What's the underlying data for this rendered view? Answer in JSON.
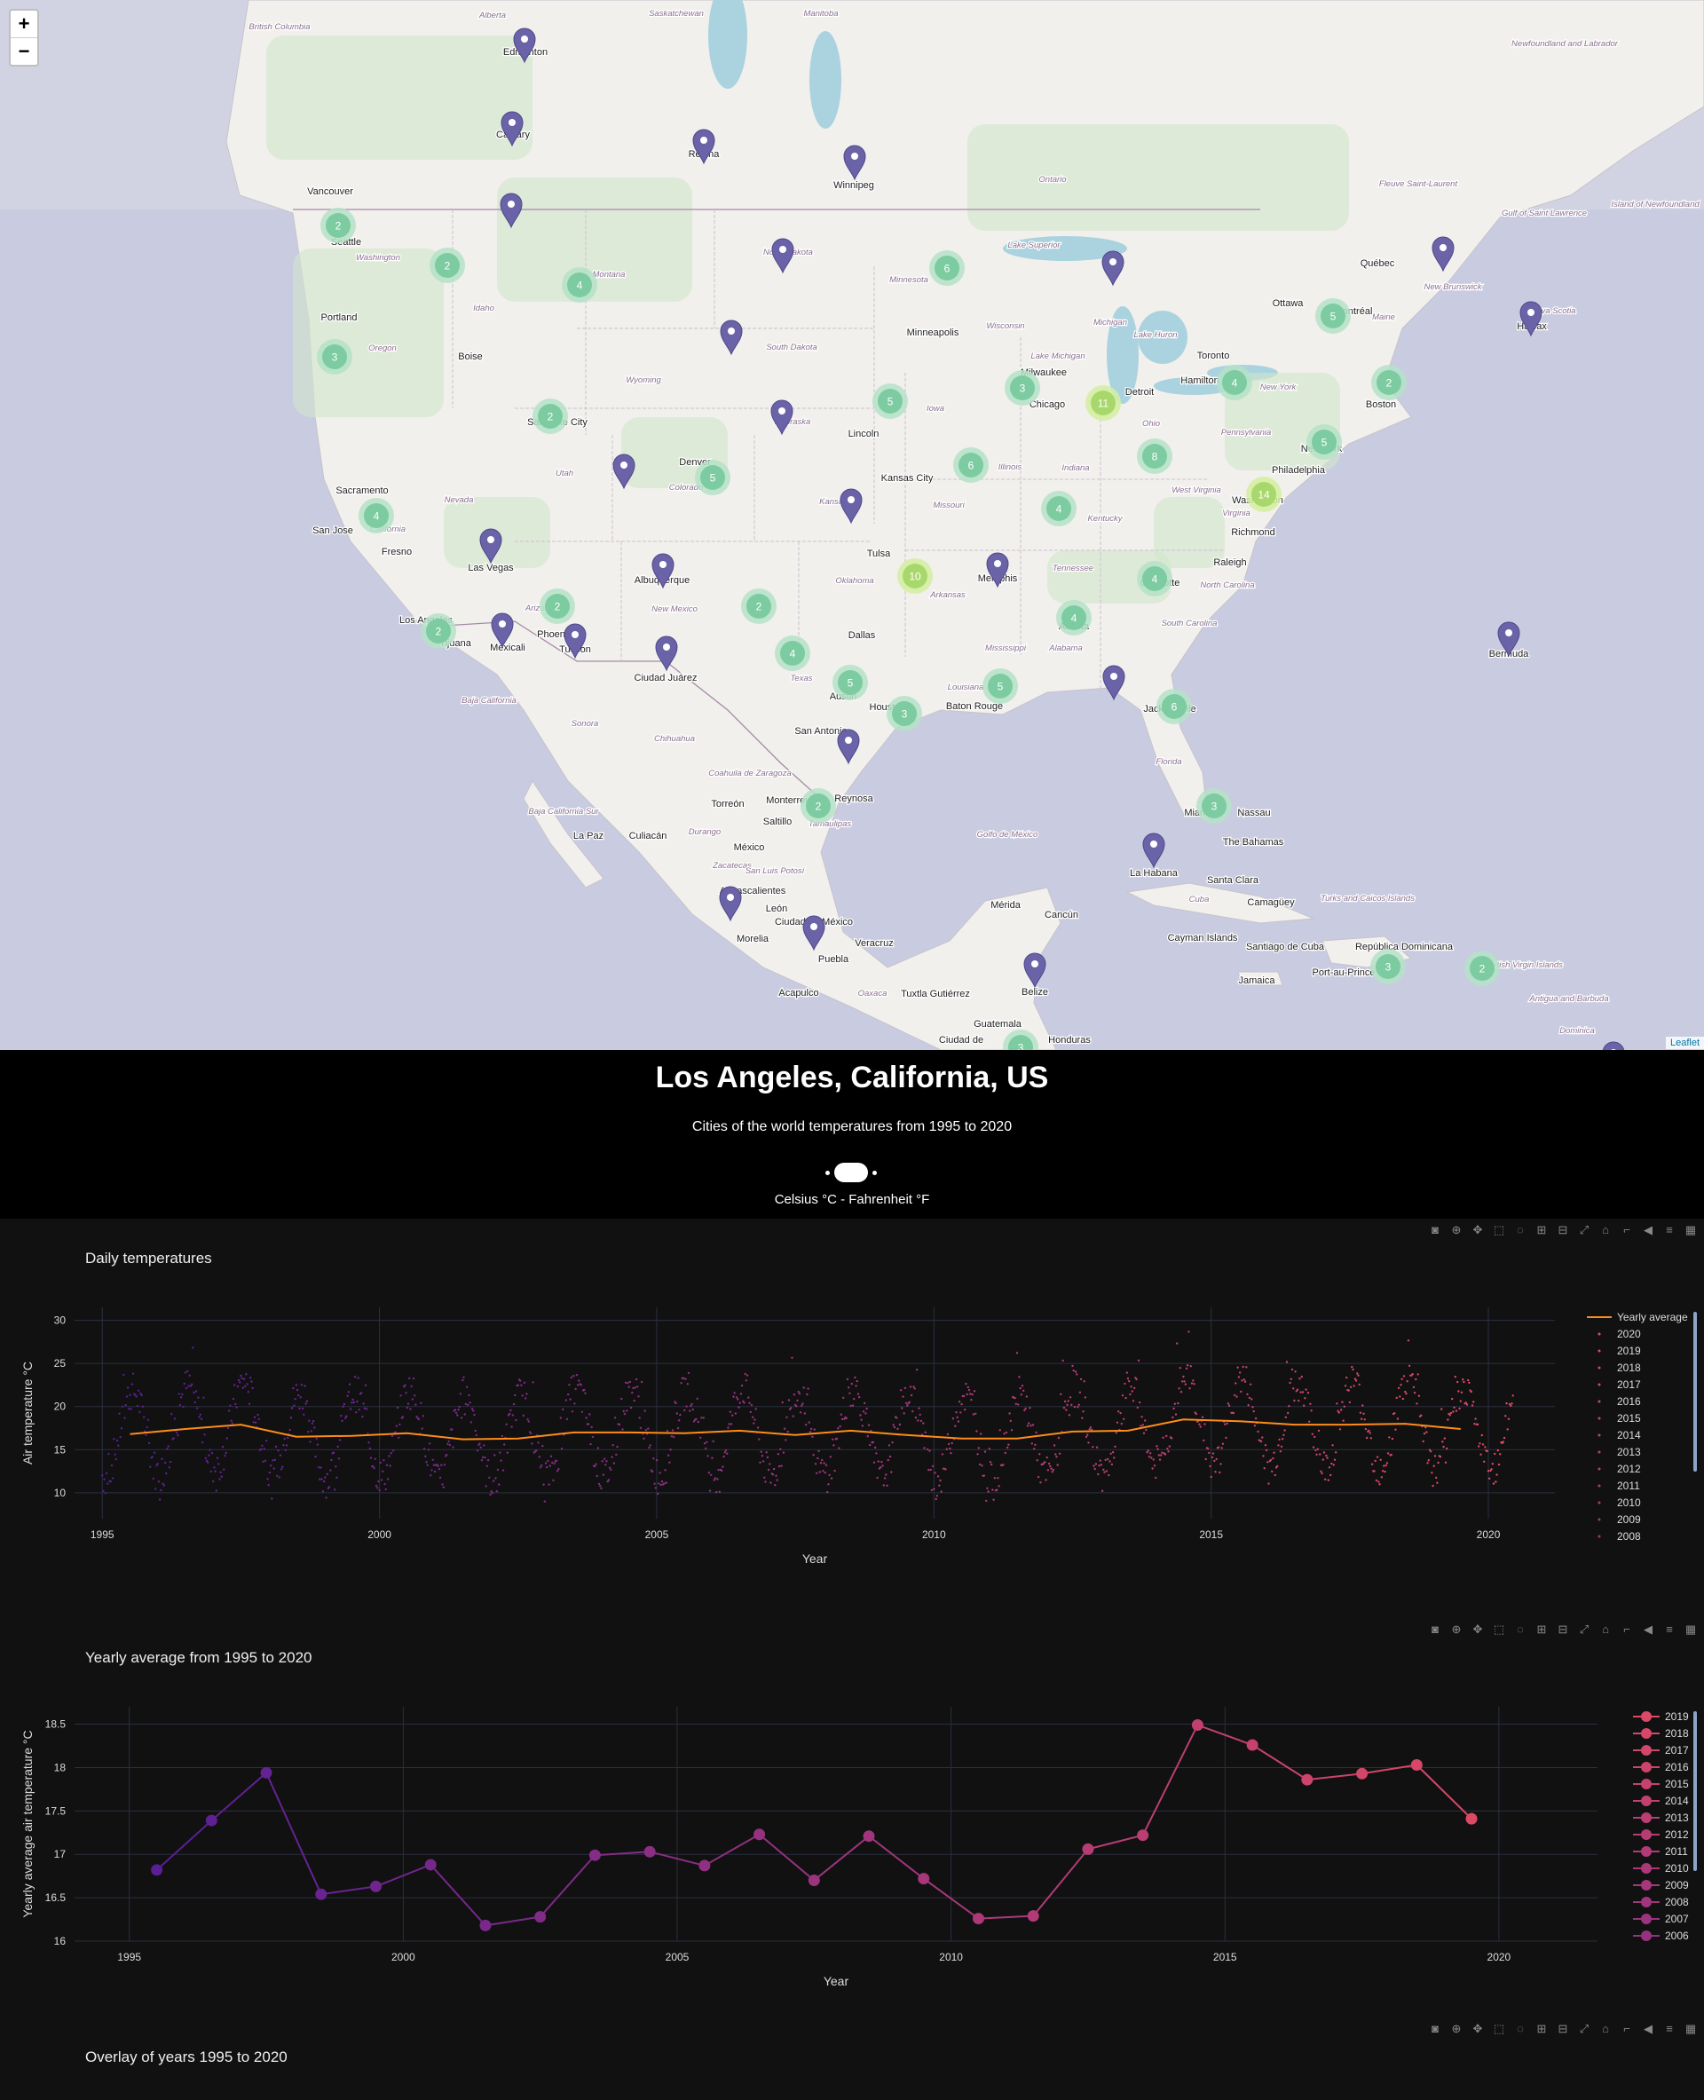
{
  "map": {
    "zoom_in": "+",
    "zoom_out": "−",
    "attribution": "Leaflet",
    "labels": [
      [
        "Edmonton",
        592,
        62,
        0
      ],
      [
        "Calgary",
        578,
        155,
        0
      ],
      [
        "Regina",
        793,
        177,
        0
      ],
      [
        "Winnipeg",
        962,
        212,
        0
      ],
      [
        "Vancouver",
        372,
        219,
        0
      ],
      [
        "Seattle",
        390,
        276,
        0
      ],
      [
        "Portland",
        382,
        361,
        0
      ],
      [
        "Boise",
        530,
        405,
        0
      ],
      [
        "Minneapolis",
        1051,
        378,
        0
      ],
      [
        "Ottawa",
        1451,
        345,
        0
      ],
      [
        "Montréal",
        1525,
        354,
        0
      ],
      [
        "Québec",
        1552,
        300,
        0
      ],
      [
        "Toronto",
        1367,
        404,
        0
      ],
      [
        "Hamilton",
        1352,
        432,
        0
      ],
      [
        "Detroit",
        1284,
        445,
        0
      ],
      [
        "Milwaukee",
        1176,
        423,
        0
      ],
      [
        "Chicago",
        1180,
        459,
        0
      ],
      [
        "Boston",
        1556,
        459,
        0
      ],
      [
        "New York",
        1489,
        509,
        0
      ],
      [
        "Philadelphia",
        1463,
        533,
        0
      ],
      [
        "Washington",
        1417,
        567,
        0
      ],
      [
        "Richmond",
        1412,
        603,
        0
      ],
      [
        "Halifax",
        1726,
        371,
        0
      ],
      [
        "Salt Lake City",
        628,
        479,
        0
      ],
      [
        "Denver",
        783,
        524,
        0
      ],
      [
        "Lincoln",
        973,
        492,
        0
      ],
      [
        "Kansas City",
        1022,
        542,
        0
      ],
      [
        "Sacramento",
        408,
        556,
        0
      ],
      [
        "San Jose",
        375,
        601,
        0
      ],
      [
        "Fresno",
        447,
        625,
        0
      ],
      [
        "Las Vegas",
        553,
        643,
        0
      ],
      [
        "Tulsa",
        990,
        627,
        0
      ],
      [
        "Raleigh",
        1386,
        637,
        0
      ],
      [
        "Memphis",
        1124,
        655,
        0
      ],
      [
        "Albuquerque",
        746,
        657,
        0
      ],
      [
        "Atlanta",
        1210,
        709,
        0
      ],
      [
        "Charlotte",
        1307,
        660,
        0
      ],
      [
        "Los Angeles",
        480,
        702,
        0
      ],
      [
        "Tijuana",
        513,
        728,
        0
      ],
      [
        "Mexicali",
        572,
        733,
        0
      ],
      [
        "Phoenix",
        625,
        718,
        0
      ],
      [
        "Tucson",
        648,
        735,
        0
      ],
      [
        "Dallas",
        971,
        719,
        0
      ],
      [
        "Ciudad Juárez",
        750,
        767,
        0
      ],
      [
        "Austin",
        950,
        788,
        0
      ],
      [
        "Houston",
        1000,
        800,
        0
      ],
      [
        "Baton Rouge",
        1098,
        799,
        0
      ],
      [
        "Jacksonville",
        1318,
        802,
        0
      ],
      [
        "San Antonio",
        925,
        827,
        0
      ],
      [
        "Bermuda",
        1700,
        740,
        0
      ],
      [
        "Miami",
        1349,
        919,
        0
      ],
      [
        "Nassau",
        1413,
        919,
        0
      ],
      [
        "The Bahamas",
        1412,
        952,
        0
      ],
      [
        "La Habana",
        1300,
        987,
        0
      ],
      [
        "Santa Clara",
        1389,
        995,
        0
      ],
      [
        "Monterrey",
        888,
        905,
        0
      ],
      [
        "Reynosa",
        962,
        903,
        0
      ],
      [
        "Torreón",
        820,
        909,
        0
      ],
      [
        "Saltillo",
        876,
        929,
        0
      ],
      [
        "México",
        844,
        958,
        0
      ],
      [
        "La Paz",
        663,
        945,
        0
      ],
      [
        "Culiacán",
        730,
        945,
        0
      ],
      [
        "Aguascalientes",
        848,
        1007,
        0
      ],
      [
        "León",
        875,
        1027,
        0
      ],
      [
        "Morelia",
        848,
        1061,
        0
      ],
      [
        "Ciudad de México",
        917,
        1042,
        0
      ],
      [
        "Puebla",
        939,
        1084,
        0
      ],
      [
        "Veracruz",
        985,
        1066,
        0
      ],
      [
        "Mérida",
        1133,
        1023,
        0
      ],
      [
        "Cancún",
        1196,
        1034,
        0
      ],
      [
        "Belize",
        1166,
        1121,
        0
      ],
      [
        "Guatemala",
        1124,
        1157,
        0
      ],
      [
        "Acapulco",
        900,
        1122,
        0
      ],
      [
        "Tuxtla Gutiérrez",
        1054,
        1123,
        0
      ],
      [
        "Camagüey",
        1432,
        1020,
        0
      ],
      [
        "Santiago de Cuba",
        1448,
        1070,
        0
      ],
      [
        "Cayman Islands",
        1355,
        1060,
        0
      ],
      [
        "Port-au-Prince",
        1514,
        1099,
        0
      ],
      [
        "Jamaica",
        1416,
        1108,
        0
      ],
      [
        "República Dominicana",
        1582,
        1070,
        0
      ],
      [
        "Ciudad de",
        1083,
        1175,
        0
      ],
      [
        "Honduras",
        1205,
        1175,
        0
      ],
      [
        "British Columbia",
        315,
        33,
        1
      ],
      [
        "Alberta",
        555,
        20,
        1
      ],
      [
        "Saskatchewan",
        762,
        18,
        1
      ],
      [
        "Manitoba",
        925,
        18,
        1
      ],
      [
        "Ontario",
        1186,
        205,
        1
      ],
      [
        "Washington",
        426,
        293,
        1
      ],
      [
        "Montana",
        686,
        312,
        1
      ],
      [
        "Idaho",
        545,
        350,
        1
      ],
      [
        "Oregon",
        431,
        395,
        1
      ],
      [
        "Wyoming",
        725,
        431,
        1
      ],
      [
        "Nevada",
        517,
        566,
        1
      ],
      [
        "Utah",
        636,
        536,
        1
      ],
      [
        "Colorado",
        773,
        552,
        1
      ],
      [
        "California",
        437,
        599,
        1
      ],
      [
        "North Dakota",
        888,
        287,
        1
      ],
      [
        "South Dakota",
        892,
        394,
        1
      ],
      [
        "Nebraska",
        893,
        478,
        1
      ],
      [
        "Kansas",
        939,
        568,
        1
      ],
      [
        "Oklahoma",
        963,
        657,
        1
      ],
      [
        "Texas",
        903,
        767,
        1
      ],
      [
        "New Mexico",
        760,
        689,
        1
      ],
      [
        "Arizona",
        608,
        688,
        1
      ],
      [
        "Minnesota",
        1024,
        318,
        1
      ],
      [
        "Iowa",
        1054,
        463,
        1
      ],
      [
        "Missouri",
        1069,
        572,
        1
      ],
      [
        "Arkansas",
        1068,
        673,
        1
      ],
      [
        "Louisiana",
        1088,
        777,
        1
      ],
      [
        "Mississippi",
        1133,
        733,
        1
      ],
      [
        "Alabama",
        1201,
        733,
        1
      ],
      [
        "Tennessee",
        1209,
        643,
        1
      ],
      [
        "Kentucky",
        1245,
        587,
        1
      ],
      [
        "Illinois",
        1138,
        529,
        1
      ],
      [
        "Indiana",
        1212,
        530,
        1
      ],
      [
        "Wisconsin",
        1133,
        370,
        1
      ],
      [
        "Michigan",
        1251,
        366,
        1
      ],
      [
        "Ohio",
        1297,
        480,
        1
      ],
      [
        "Pennsylvania",
        1404,
        490,
        1
      ],
      [
        "West Virginia",
        1348,
        555,
        1
      ],
      [
        "Virginia",
        1393,
        581,
        1
      ],
      [
        "North Carolina",
        1383,
        662,
        1
      ],
      [
        "South Carolina",
        1340,
        705,
        1
      ],
      [
        "Florida",
        1317,
        861,
        1
      ],
      [
        "New York",
        1440,
        439,
        1
      ],
      [
        "Maine",
        1559,
        360,
        1
      ],
      [
        "New Brunswick",
        1637,
        326,
        1
      ],
      [
        "Nova Scotia",
        1750,
        353,
        1
      ],
      [
        "Lake Superior",
        1165,
        279,
        1
      ],
      [
        "Lake Huron",
        1302,
        380,
        1
      ],
      [
        "Lake Michigan",
        1192,
        404,
        1
      ],
      [
        "Baja California",
        551,
        792,
        1
      ],
      [
        "Sonora",
        659,
        818,
        1
      ],
      [
        "Chihuahua",
        760,
        835,
        1
      ],
      [
        "Coahuila de Zaragoza",
        845,
        874,
        1
      ],
      [
        "Durango",
        794,
        940,
        1
      ],
      [
        "Tamaulipas",
        935,
        931,
        1
      ],
      [
        "Zacatecas",
        825,
        978,
        1
      ],
      [
        "San Luis Potosí",
        873,
        984,
        1
      ],
      [
        "Baja California Sur",
        635,
        917,
        1
      ],
      [
        "Oaxaca",
        983,
        1122,
        1
      ],
      [
        "Golfo de México",
        1135,
        943,
        1
      ],
      [
        "Cuba",
        1351,
        1016,
        1
      ],
      [
        "Newfoundland and Labrador",
        1763,
        52,
        1
      ],
      [
        "Gulf of Saint Lawrence",
        1740,
        243,
        1
      ],
      [
        "Island of Newfoundland",
        1865,
        233,
        1
      ],
      [
        "Fleuve Saint-Laurent",
        1598,
        210,
        1
      ],
      [
        "Turks and Caicos Islands",
        1541,
        1015,
        1
      ],
      [
        "British Virgin Islands",
        1718,
        1090,
        1
      ],
      [
        "Antigua and Barbuda",
        1768,
        1128,
        1
      ],
      [
        "Dominica",
        1777,
        1164,
        1
      ]
    ],
    "markers": [
      [
        591,
        48
      ],
      [
        577,
        142
      ],
      [
        793,
        162
      ],
      [
        963,
        180
      ],
      [
        576,
        234
      ],
      [
        882,
        285
      ],
      [
        1254,
        299
      ],
      [
        1626,
        283
      ],
      [
        1725,
        356
      ],
      [
        824,
        377
      ],
      [
        881,
        467
      ],
      [
        703,
        528
      ],
      [
        959,
        567
      ],
      [
        553,
        612
      ],
      [
        747,
        640
      ],
      [
        1124,
        639
      ],
      [
        566,
        707
      ],
      [
        648,
        719
      ],
      [
        751,
        733
      ],
      [
        1700,
        717
      ],
      [
        1255,
        766
      ],
      [
        956,
        838
      ],
      [
        1300,
        955
      ],
      [
        823,
        1015
      ],
      [
        917,
        1048
      ],
      [
        1166,
        1090
      ],
      [
        1818,
        1190
      ]
    ],
    "clusters": [
      [
        2,
        381,
        254,
        "g"
      ],
      [
        2,
        504,
        299,
        "g"
      ],
      [
        4,
        653,
        321,
        "g"
      ],
      [
        3,
        377,
        402,
        "g"
      ],
      [
        2,
        620,
        469,
        "g"
      ],
      [
        5,
        803,
        538,
        "g"
      ],
      [
        4,
        424,
        581,
        "g"
      ],
      [
        2,
        628,
        683,
        "g"
      ],
      [
        2,
        494,
        711,
        "g"
      ],
      [
        2,
        855,
        683,
        "g"
      ],
      [
        4,
        893,
        736,
        "g"
      ],
      [
        5,
        958,
        769,
        "g"
      ],
      [
        3,
        1019,
        804,
        "g"
      ],
      [
        5,
        1127,
        773,
        "g"
      ],
      [
        10,
        1031,
        649,
        "y"
      ],
      [
        6,
        1067,
        302,
        "g"
      ],
      [
        5,
        1003,
        452,
        "g"
      ],
      [
        6,
        1094,
        524,
        "g"
      ],
      [
        3,
        1152,
        437,
        "g"
      ],
      [
        11,
        1243,
        454,
        "y"
      ],
      [
        4,
        1193,
        573,
        "g"
      ],
      [
        4,
        1301,
        652,
        "g"
      ],
      [
        4,
        1210,
        696,
        "g"
      ],
      [
        8,
        1301,
        514,
        "g"
      ],
      [
        14,
        1424,
        557,
        "y"
      ],
      [
        4,
        1391,
        431,
        "g"
      ],
      [
        5,
        1502,
        356,
        "g"
      ],
      [
        2,
        1565,
        431,
        "g"
      ],
      [
        5,
        1492,
        498,
        "g"
      ],
      [
        6,
        1323,
        796,
        "g"
      ],
      [
        3,
        1368,
        908,
        "g"
      ],
      [
        2,
        922,
        908,
        "g"
      ],
      [
        3,
        1564,
        1089,
        "g"
      ],
      [
        2,
        1670,
        1091,
        "g"
      ],
      [
        3,
        1150,
        1180,
        "g"
      ]
    ]
  },
  "header": {
    "city": "Los Angeles, California, US",
    "subtitle": "Cities of the world temperatures from 1995 to 2020",
    "unit_label": "Celsius °C - Fahrenheit °F"
  },
  "modebar_icons": [
    "camera-icon",
    "zoom-icon",
    "pan-icon",
    "box-select-icon",
    "lasso-icon",
    "zoom-in-icon",
    "zoom-out-icon",
    "autoscale-icon",
    "reset-axes-icon",
    "spike-lines-icon",
    "hover-closest-icon",
    "hover-compare-icon",
    "plotly-logo-icon"
  ],
  "daily": {
    "title": " Daily temperatures",
    "xlabel": "Year",
    "ylabel": "Air temperature  °C",
    "legend": [
      "Yearly average",
      "2020",
      "2019",
      "2018",
      "2017",
      "2016",
      "2015",
      "2014",
      "2013",
      "2012",
      "2011",
      "2010",
      "2009",
      "2008"
    ]
  },
  "yearly": {
    "title": " Yearly average from 1995 to 2020",
    "xlabel": "Year",
    "ylabel": "Yearly average air temperature  °C",
    "legend": [
      "2019",
      "2018",
      "2017",
      "2016",
      "2015",
      "2014",
      "2013",
      "2012",
      "2011",
      "2010",
      "2009",
      "2008",
      "2007",
      "2006"
    ]
  },
  "overlay": {
    "title": " Overlay of years 1995 to 2020"
  },
  "chart_data": [
    {
      "type": "scatter",
      "title": "Daily temperatures",
      "xlabel": "Year",
      "ylabel": "Air temperature °C",
      "xlim": [
        1994.5,
        2021.2
      ],
      "ylim": [
        7,
        31.5
      ],
      "x_ticks": [
        1995,
        2000,
        2005,
        2010,
        2015,
        2020
      ],
      "y_ticks": [
        10,
        15,
        20,
        25,
        30
      ],
      "series": [
        {
          "name": "Yearly average",
          "type": "line",
          "x": [
            1995.5,
            1996.5,
            1997.5,
            1998.5,
            1999.5,
            2000.5,
            2001.5,
            2002.5,
            2003.5,
            2004.5,
            2005.5,
            2006.5,
            2007.5,
            2008.5,
            2009.5,
            2010.5,
            2011.5,
            2012.5,
            2013.5,
            2014.5,
            2015.5,
            2016.5,
            2017.5,
            2018.5,
            2019.5
          ],
          "y": [
            16.8,
            17.4,
            17.9,
            16.5,
            16.6,
            16.9,
            16.2,
            16.3,
            17.0,
            17.0,
            16.9,
            17.2,
            16.7,
            17.2,
            16.7,
            16.3,
            16.3,
            17.1,
            17.2,
            18.5,
            18.3,
            17.9,
            17.9,
            18.0,
            17.4
          ]
        }
      ],
      "daily_points": {
        "years": "1995–2020",
        "amplitude_c": 5,
        "noise_c": 2.2
      }
    },
    {
      "type": "line",
      "title": "Yearly average from 1995 to 2020",
      "xlabel": "Year",
      "ylabel": "Yearly average air temperature °C",
      "xlim": [
        1994,
        2021.8
      ],
      "ylim": [
        16,
        18.7
      ],
      "x_ticks": [
        1995,
        2000,
        2005,
        2010,
        2015,
        2020
      ],
      "y_ticks": [
        16,
        16.5,
        17,
        17.5,
        18,
        18.5
      ],
      "x": [
        1995.5,
        1996.5,
        1997.5,
        1998.5,
        1999.5,
        2000.5,
        2001.5,
        2002.5,
        2003.5,
        2004.5,
        2005.5,
        2006.5,
        2007.5,
        2008.5,
        2009.5,
        2010.5,
        2011.5,
        2012.5,
        2013.5,
        2014.5,
        2015.5,
        2016.5,
        2017.5,
        2018.5,
        2019.5
      ],
      "y": [
        16.82,
        17.39,
        17.94,
        16.54,
        16.63,
        16.88,
        16.18,
        16.28,
        16.99,
        17.03,
        16.87,
        17.23,
        16.7,
        17.21,
        16.72,
        16.26,
        16.29,
        17.06,
        17.22,
        18.49,
        18.26,
        17.86,
        17.93,
        18.03,
        17.41
      ]
    }
  ]
}
